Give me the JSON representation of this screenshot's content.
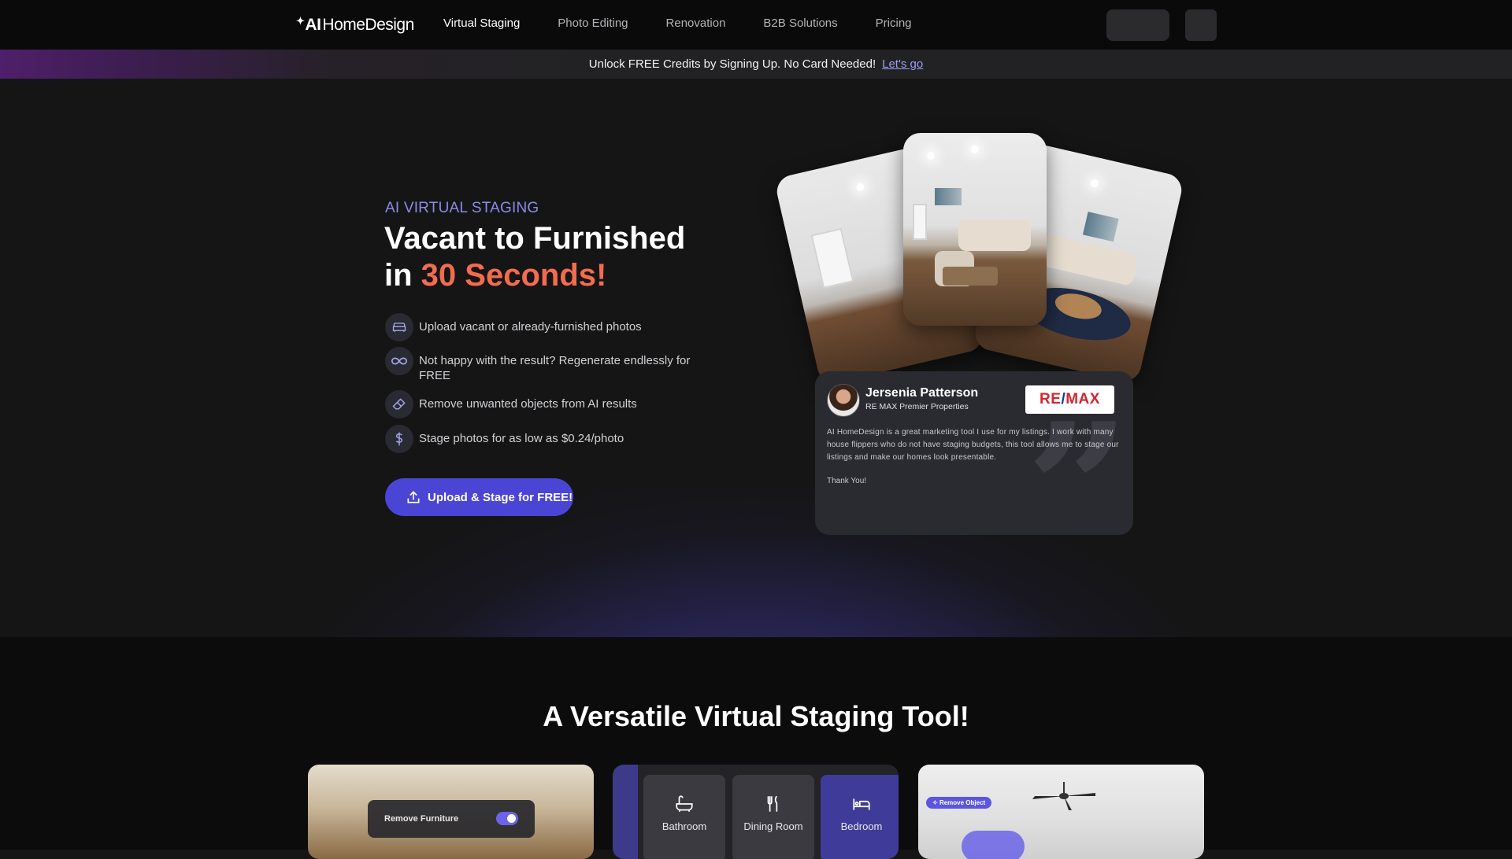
{
  "nav": {
    "logo_spark": "✦",
    "logo_ai": "AI",
    "logo_rest": "HomeDesign",
    "links": [
      "Virtual Staging",
      "Photo Editing",
      "Renovation",
      "B2B Solutions",
      "Pricing"
    ]
  },
  "banner": {
    "text": "Unlock FREE Credits by Signing Up. No Card Needed!",
    "link": "Let's go"
  },
  "hero": {
    "eyebrow": "AI VIRTUAL STAGING",
    "title_line1": "Vacant to Furnished",
    "title_in": "in ",
    "title_accent": "30 Seconds!",
    "features": [
      {
        "icon": "sofa-icon",
        "text": "Upload vacant or already-furnished photos"
      },
      {
        "icon": "infinity-icon",
        "text": "Not happy with the result? Regenerate endlessly for FREE"
      },
      {
        "icon": "eraser-icon",
        "text": "Remove unwanted objects from AI results"
      },
      {
        "icon": "dollar-icon",
        "text": "Stage photos for as low as $0.24/photo"
      }
    ],
    "cta": "Upload & Stage for FREE!"
  },
  "testimonial": {
    "name": "Jersenia Patterson",
    "company": "RE MAX Premier Properties",
    "logo_r1": "RE",
    "logo_slash": "/",
    "logo_r2": "MAX",
    "body": "AI HomeDesign is a great marketing tool I use for my listings. I work with many house flippers who do not have staging budgets, this tool allows me to stage our listings and make our homes look presentable.",
    "thanks": "Thank You!",
    "quote_mark": "”"
  },
  "section2": {
    "title": "A Versatile Virtual Staging Tool!",
    "remove_furniture": "Remove Furniture",
    "rooms": [
      "Bathroom",
      "Dining Room",
      "Bedroom"
    ],
    "remove_object_tag": "Remove Object"
  },
  "colors": {
    "accent": "#4b45d6",
    "eyebrow": "#8d8ae8",
    "highlight": "#f26c4f"
  }
}
